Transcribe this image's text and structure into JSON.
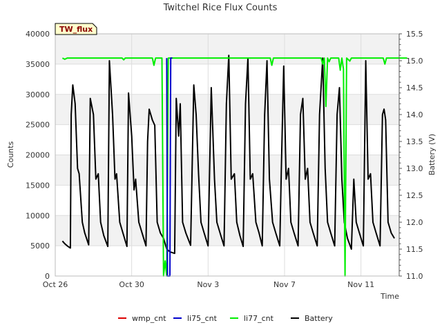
{
  "chart_data": {
    "type": "line",
    "title": "Twitchel Rice Flux Counts",
    "xlabel": "Time",
    "ylabel": "Counts",
    "y2label": "Battery (V)",
    "badge": "TW_flux",
    "ylim": [
      0,
      40000
    ],
    "y2lim": [
      11.0,
      15.5
    ],
    "xlim": [
      "2023-10-26",
      "2023-11-13"
    ],
    "yticks": [
      "0",
      "5000",
      "10000",
      "15000",
      "20000",
      "25000",
      "30000",
      "35000",
      "40000"
    ],
    "y2ticks": [
      "11.0",
      "11.5",
      "12.0",
      "12.5",
      "13.0",
      "13.5",
      "14.0",
      "14.5",
      "15.0",
      "15.5"
    ],
    "xticks": [
      {
        "label": "Oct 26",
        "value": "2023-10-26"
      },
      {
        "label": "Oct 30",
        "value": "2023-10-30"
      },
      {
        "label": "Nov 3",
        "value": "2023-11-03"
      },
      {
        "label": "Nov 7",
        "value": "2023-11-07"
      },
      {
        "label": "Nov 11",
        "value": "2023-11-11"
      }
    ],
    "grid": true,
    "banded_background": true,
    "legend_placement": "bottom-center",
    "series": [
      {
        "name": "wmp_cnt",
        "color": "#dd0000",
        "axis": "left",
        "points": []
      },
      {
        "name": "li75_cnt",
        "color": "#0000cc",
        "axis": "left",
        "points": [
          [
            "2023-10-31 20:00",
            36000
          ],
          [
            "2023-10-31 21:00",
            0
          ],
          [
            "2023-11-01 00:00",
            0
          ],
          [
            "2023-11-01 01:00",
            36000
          ],
          [
            "2023-11-01 03:00",
            36000
          ]
        ]
      },
      {
        "name": "li77_cnt",
        "color": "#00ee00",
        "axis": "left",
        "points": [
          [
            "2023-10-26 09:00",
            36000
          ],
          [
            "2023-10-26 12:00",
            35800
          ],
          [
            "2023-10-26 15:00",
            36000
          ],
          [
            "2023-10-29 12:00",
            36000
          ],
          [
            "2023-10-29 14:00",
            35700
          ],
          [
            "2023-10-29 16:00",
            36000
          ],
          [
            "2023-10-31 02:00",
            36000
          ],
          [
            "2023-10-31 04:00",
            34800
          ],
          [
            "2023-10-31 06:00",
            36000
          ],
          [
            "2023-10-31 14:00",
            36000
          ],
          [
            "2023-10-31 16:00",
            0
          ],
          [
            "2023-10-31 18:00",
            2500
          ],
          [
            "2023-10-31 20:00",
            0
          ],
          [
            "2023-10-31 22:00",
            36000
          ],
          [
            "2023-11-06 06:00",
            36000
          ],
          [
            "2023-11-06 08:00",
            34800
          ],
          [
            "2023-11-06 10:00",
            36000
          ],
          [
            "2023-11-08 22:00",
            36000
          ],
          [
            "2023-11-09 00:00",
            35000
          ],
          [
            "2023-11-09 02:00",
            36000
          ],
          [
            "2023-11-09 04:00",
            28000
          ],
          [
            "2023-11-09 06:00",
            36000
          ],
          [
            "2023-11-09 08:00",
            35400
          ],
          [
            "2023-11-09 10:00",
            36000
          ],
          [
            "2023-11-09 20:00",
            36000
          ],
          [
            "2023-11-09 22:00",
            34000
          ],
          [
            "2023-11-10 00:00",
            36000
          ],
          [
            "2023-11-10 02:00",
            34200
          ],
          [
            "2023-11-10 04:00",
            0
          ],
          [
            "2023-11-10 06:00",
            36000
          ],
          [
            "2023-11-10 10:00",
            35500
          ],
          [
            "2023-11-10 12:00",
            36000
          ],
          [
            "2023-11-12 04:00",
            36000
          ],
          [
            "2023-11-12 06:00",
            35000
          ],
          [
            "2023-11-12 08:00",
            36000
          ],
          [
            "2023-11-13 10:00",
            36000
          ]
        ]
      },
      {
        "name": "Battery",
        "color": "#000000",
        "axis": "right",
        "points": [
          [
            "2023-10-26 09:00",
            11.65
          ],
          [
            "2023-10-26 12:00",
            11.6
          ],
          [
            "2023-10-26 16:00",
            11.55
          ],
          [
            "2023-10-26 19:00",
            11.52
          ],
          [
            "2023-10-26 20:00",
            14.0
          ],
          [
            "2023-10-26 22:00",
            14.55
          ],
          [
            "2023-10-27 01:00",
            14.2
          ],
          [
            "2023-10-27 04:00",
            13.0
          ],
          [
            "2023-10-27 06:00",
            12.9
          ],
          [
            "2023-10-27 10:00",
            12.0
          ],
          [
            "2023-10-27 13:00",
            11.8
          ],
          [
            "2023-10-27 18:00",
            11.58
          ],
          [
            "2023-10-27 20:00",
            14.3
          ],
          [
            "2023-10-28 00:00",
            14.0
          ],
          [
            "2023-10-28 03:00",
            12.8
          ],
          [
            "2023-10-28 06:00",
            12.9
          ],
          [
            "2023-10-28 09:00",
            12.0
          ],
          [
            "2023-10-28 13:00",
            11.75
          ],
          [
            "2023-10-28 18:00",
            11.55
          ],
          [
            "2023-10-28 20:00",
            15.0
          ],
          [
            "2023-10-29 00:00",
            14.0
          ],
          [
            "2023-10-29 03:00",
            12.8
          ],
          [
            "2023-10-29 05:00",
            12.9
          ],
          [
            "2023-10-29 09:00",
            12.0
          ],
          [
            "2023-10-29 13:00",
            11.8
          ],
          [
            "2023-10-29 18:00",
            11.55
          ],
          [
            "2023-10-29 20:00",
            14.4
          ],
          [
            "2023-10-30 00:00",
            13.6
          ],
          [
            "2023-10-30 03:00",
            12.6
          ],
          [
            "2023-10-30 05:00",
            12.8
          ],
          [
            "2023-10-30 09:00",
            12.0
          ],
          [
            "2023-10-30 13:00",
            11.8
          ],
          [
            "2023-10-30 18:00",
            11.56
          ],
          [
            "2023-10-30 20:00",
            13.5
          ],
          [
            "2023-10-30 22:00",
            14.1
          ],
          [
            "2023-10-31 02:00",
            13.9
          ],
          [
            "2023-10-31 05:00",
            13.8
          ],
          [
            "2023-10-31 08:00",
            12.0
          ],
          [
            "2023-10-31 12:00",
            11.8
          ],
          [
            "2023-10-31 16:00",
            11.7
          ],
          [
            "2023-10-31 20:00",
            11.5
          ],
          [
            "2023-11-01 00:00",
            11.45
          ],
          [
            "2023-11-01 06:00",
            11.42
          ],
          [
            "2023-11-01 08:00",
            14.3
          ],
          [
            "2023-11-01 11:00",
            13.6
          ],
          [
            "2023-11-01 13:00",
            14.2
          ],
          [
            "2023-11-01 16:00",
            12.0
          ],
          [
            "2023-11-01 20:00",
            11.8
          ],
          [
            "2023-11-02 02:00",
            11.57
          ],
          [
            "2023-11-02 06:00",
            14.55
          ],
          [
            "2023-11-02 09:00",
            14.0
          ],
          [
            "2023-11-02 12:00",
            12.9
          ],
          [
            "2023-11-02 15:00",
            12.0
          ],
          [
            "2023-11-02 19:00",
            11.8
          ],
          [
            "2023-11-03 00:00",
            11.56
          ],
          [
            "2023-11-03 04:00",
            14.5
          ],
          [
            "2023-11-03 08:00",
            12.8
          ],
          [
            "2023-11-03 11:00",
            12.0
          ],
          [
            "2023-11-03 16:00",
            11.75
          ],
          [
            "2023-11-03 20:00",
            11.56
          ],
          [
            "2023-11-03 23:00",
            14.2
          ],
          [
            "2023-11-04 02:00",
            15.1
          ],
          [
            "2023-11-04 05:00",
            12.8
          ],
          [
            "2023-11-04 09:00",
            12.9
          ],
          [
            "2023-11-04 12:00",
            12.0
          ],
          [
            "2023-11-04 16:00",
            11.75
          ],
          [
            "2023-11-04 20:00",
            11.55
          ],
          [
            "2023-11-04 23:00",
            14.2
          ],
          [
            "2023-11-05 02:00",
            15.05
          ],
          [
            "2023-11-05 05:00",
            12.8
          ],
          [
            "2023-11-05 08:00",
            12.9
          ],
          [
            "2023-11-05 12:00",
            12.0
          ],
          [
            "2023-11-05 16:00",
            11.8
          ],
          [
            "2023-11-05 20:00",
            11.56
          ],
          [
            "2023-11-05 23:00",
            14.0
          ],
          [
            "2023-11-06 02:00",
            15.0
          ],
          [
            "2023-11-06 05:00",
            12.8
          ],
          [
            "2023-11-06 09:00",
            12.0
          ],
          [
            "2023-11-06 13:00",
            11.8
          ],
          [
            "2023-11-06 18:00",
            11.56
          ],
          [
            "2023-11-06 20:00",
            13.0
          ],
          [
            "2023-11-06 23:00",
            14.9
          ],
          [
            "2023-11-07 02:00",
            12.8
          ],
          [
            "2023-11-07 05:00",
            13.0
          ],
          [
            "2023-11-07 08:00",
            12.0
          ],
          [
            "2023-11-07 12:00",
            11.8
          ],
          [
            "2023-11-07 17:00",
            11.56
          ],
          [
            "2023-11-07 20:00",
            14.0
          ],
          [
            "2023-11-07 23:00",
            14.3
          ],
          [
            "2023-11-08 02:00",
            12.8
          ],
          [
            "2023-11-08 05:00",
            13.0
          ],
          [
            "2023-11-08 08:00",
            12.0
          ],
          [
            "2023-11-08 12:00",
            11.8
          ],
          [
            "2023-11-08 17:00",
            11.56
          ],
          [
            "2023-11-08 20:00",
            14.0
          ],
          [
            "2023-11-09 00:00",
            15.05
          ],
          [
            "2023-11-09 03:00",
            13.0
          ],
          [
            "2023-11-09 06:00",
            12.0
          ],
          [
            "2023-11-09 10:00",
            11.8
          ],
          [
            "2023-11-09 15:00",
            11.56
          ],
          [
            "2023-11-09 18:00",
            14.0
          ],
          [
            "2023-11-09 21:00",
            14.5
          ],
          [
            "2023-11-10 00:00",
            12.8
          ],
          [
            "2023-11-10 03:00",
            12.0
          ],
          [
            "2023-11-10 07:00",
            11.7
          ],
          [
            "2023-11-10 12:00",
            11.5
          ],
          [
            "2023-11-10 15:00",
            12.8
          ],
          [
            "2023-11-10 18:00",
            12.0
          ],
          [
            "2023-11-10 22:00",
            11.8
          ],
          [
            "2023-11-11 03:00",
            11.56
          ],
          [
            "2023-11-11 06:00",
            15.0
          ],
          [
            "2023-11-11 09:00",
            12.8
          ],
          [
            "2023-11-11 12:00",
            12.9
          ],
          [
            "2023-11-11 15:00",
            12.0
          ],
          [
            "2023-11-11 19:00",
            11.8
          ],
          [
            "2023-11-12 00:00",
            11.56
          ],
          [
            "2023-11-12 03:00",
            14.0
          ],
          [
            "2023-11-12 05:00",
            14.1
          ],
          [
            "2023-11-12 07:00",
            13.9
          ],
          [
            "2023-11-12 10:00",
            12.0
          ],
          [
            "2023-11-12 14:00",
            11.8
          ],
          [
            "2023-11-12 18:00",
            11.7
          ]
        ]
      }
    ]
  }
}
